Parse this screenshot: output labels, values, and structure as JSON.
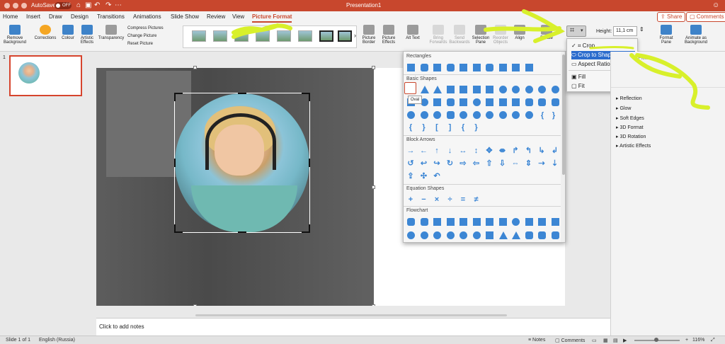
{
  "titlebar": {
    "autosave": "AutoSave",
    "toggle": "OFF",
    "title": "Presentation1"
  },
  "tabs": [
    {
      "label": "Home"
    },
    {
      "label": "Insert"
    },
    {
      "label": "Draw"
    },
    {
      "label": "Design"
    },
    {
      "label": "Transitions"
    },
    {
      "label": "Animations"
    },
    {
      "label": "Slide Show"
    },
    {
      "label": "Review"
    },
    {
      "label": "View"
    },
    {
      "label": "Picture Format"
    }
  ],
  "header_buttons": {
    "share": "Share",
    "comments": "Comments"
  },
  "ribbon": {
    "remove_background": "Remove Background",
    "corrections": "Corrections",
    "colour": "Colour",
    "artistic_effects": "Artistic Effects",
    "transparency": "Transparency",
    "compress": "Compress Pictures",
    "change": "Change Picture",
    "reset": "Reset Picture",
    "picture_border": "Picture Border",
    "picture_effects": "Picture Effects",
    "alt_text": "Alt Text",
    "bring_forwards": "Bring Forwards",
    "send_backwards": "Send Backwards",
    "selection_pane": "Selection Pane",
    "reorder_objects": "Reorder Objects",
    "align": "Align",
    "rotate": "Rotate",
    "height_label": "Height:",
    "height_value": "11,1 cm",
    "format_pane": "Format Pane",
    "animate_bg": "Animate as Background"
  },
  "thumbnails": {
    "slide_number": "1"
  },
  "shapes_dropdown": {
    "rectangles": "Rectangles",
    "basic_shapes": "Basic Shapes",
    "block_arrows": "Block Arrows",
    "equation_shapes": "Equation Shapes",
    "flowchart": "Flowchart",
    "tooltip": "Oval"
  },
  "crop_menu": {
    "crop": "Crop",
    "crop_to_shape": "Crop to Shape",
    "aspect_ratio": "Aspect Ratio",
    "fill": "Fill",
    "fit": "Fit"
  },
  "format_pane": {
    "partial": "Picture",
    "items": [
      "Reflection",
      "Glow",
      "Soft Edges",
      "3D Format",
      "3D Rotation",
      "Artistic Effects"
    ]
  },
  "notes_placeholder": "Click to add notes",
  "status": {
    "slide": "Slide 1 of 1",
    "language": "English (Russia)",
    "notes": "Notes",
    "comments": "Comments",
    "zoom": "116%"
  },
  "colors": {
    "accent": "#c8472d",
    "shape_blue": "#3c86d4",
    "highlight": "#d8f02b",
    "selection": "#2b6ccd"
  }
}
